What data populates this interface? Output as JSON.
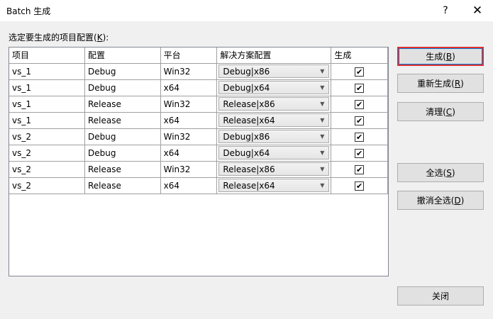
{
  "window": {
    "title": "Batch 生成",
    "help_label": "?",
    "close_label": "✕"
  },
  "prompt": {
    "pre": "选定要生成的项目配置(",
    "mnemonic": "K",
    "post": "):"
  },
  "table": {
    "headers": [
      "项目",
      "配置",
      "平台",
      "解决方案配置",
      "生成"
    ],
    "rows": [
      {
        "project": "vs_1",
        "config": "Debug",
        "platform": "Win32",
        "solution": "Debug|x86",
        "build": true
      },
      {
        "project": "vs_1",
        "config": "Debug",
        "platform": "x64",
        "solution": "Debug|x64",
        "build": true
      },
      {
        "project": "vs_1",
        "config": "Release",
        "platform": "Win32",
        "solution": "Release|x86",
        "build": true
      },
      {
        "project": "vs_1",
        "config": "Release",
        "platform": "x64",
        "solution": "Release|x64",
        "build": true
      },
      {
        "project": "vs_2",
        "config": "Debug",
        "platform": "Win32",
        "solution": "Debug|x86",
        "build": true
      },
      {
        "project": "vs_2",
        "config": "Debug",
        "platform": "x64",
        "solution": "Debug|x64",
        "build": true
      },
      {
        "project": "vs_2",
        "config": "Release",
        "platform": "Win32",
        "solution": "Release|x86",
        "build": true
      },
      {
        "project": "vs_2",
        "config": "Release",
        "platform": "x64",
        "solution": "Release|x64",
        "build": true
      }
    ],
    "dropdown_icon": "chevron-down-icon",
    "check_glyph": "✔"
  },
  "buttons": {
    "build": {
      "pre": "生成(",
      "key": "B",
      "post": ")"
    },
    "rebuild": {
      "pre": "重新生成(",
      "key": "R",
      "post": ")"
    },
    "clean": {
      "pre": "清理(",
      "key": "C",
      "post": ")"
    },
    "select_all": {
      "pre": "全选(",
      "key": "S",
      "post": ")"
    },
    "deselect_all": {
      "pre": "撤消全选(",
      "key": "D",
      "post": ")"
    },
    "close": {
      "label": "关闭"
    }
  },
  "colors": {
    "focus_border": "#e03030",
    "background": "#f0f0f0"
  }
}
